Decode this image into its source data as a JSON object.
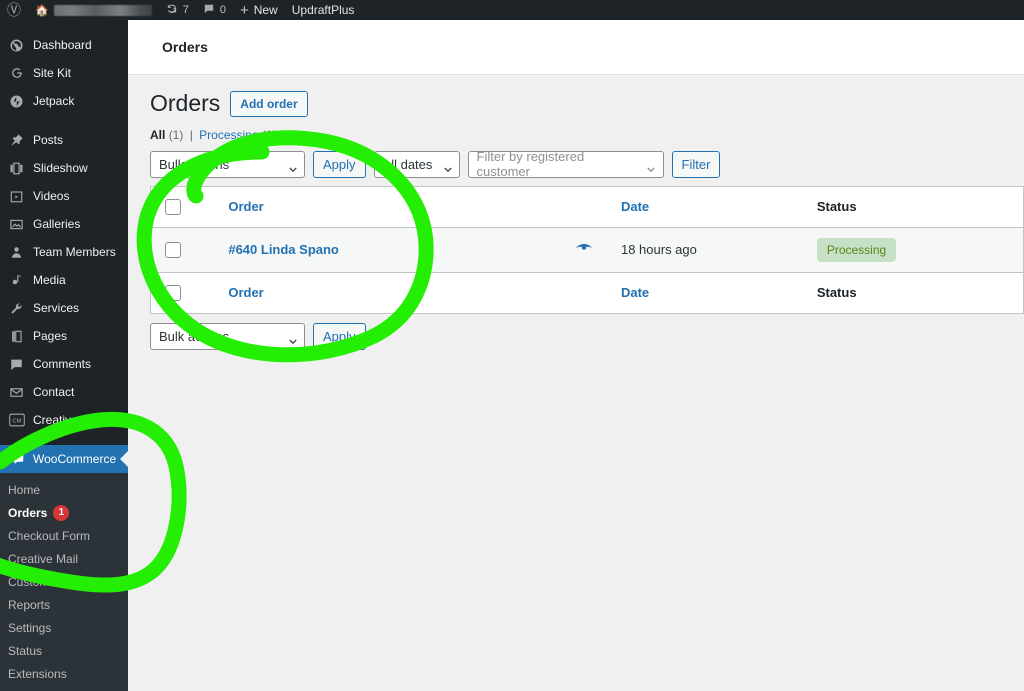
{
  "adminbar": {
    "logo_icon": "wordpress-logo-icon",
    "home_icon": "home-icon",
    "site_name": "",
    "updates_icon": "updates-icon",
    "updates_count": "7",
    "comments_icon": "comment-bubble-icon",
    "comments_count": "0",
    "new_icon": "plus-icon",
    "new_label": "New",
    "updraft_label": "UpdraftPlus"
  },
  "sidebar": {
    "items": [
      {
        "label": "Dashboard",
        "icon": "dashboard-icon"
      },
      {
        "label": "Site Kit",
        "icon": "site-kit-g-icon"
      },
      {
        "label": "Jetpack",
        "icon": "jetpack-icon"
      },
      {
        "label": "Posts",
        "icon": "pin-icon"
      },
      {
        "label": "Slideshow",
        "icon": "slideshow-icon"
      },
      {
        "label": "Videos",
        "icon": "video-icon"
      },
      {
        "label": "Galleries",
        "icon": "gallery-icon"
      },
      {
        "label": "Team Members",
        "icon": "person-icon"
      },
      {
        "label": "Media",
        "icon": "media-icon"
      },
      {
        "label": "Services",
        "icon": "wrench-icon"
      },
      {
        "label": "Pages",
        "icon": "pages-icon"
      },
      {
        "label": "Comments",
        "icon": "comment-bubble-icon"
      },
      {
        "label": "Contact",
        "icon": "envelope-icon"
      },
      {
        "label": "Creative Mail",
        "icon": "creative-mail-cm-icon"
      }
    ],
    "current": {
      "label": "WooCommerce",
      "icon": "woocommerce-icon"
    },
    "submenu": [
      {
        "label": "Home",
        "badge": ""
      },
      {
        "label": "Orders",
        "badge": "1",
        "active": true
      },
      {
        "label": "Checkout Form",
        "badge": ""
      },
      {
        "label": "Creative Mail",
        "badge": ""
      },
      {
        "label": "Customers",
        "badge": ""
      },
      {
        "label": "Reports",
        "badge": ""
      },
      {
        "label": "Settings",
        "badge": ""
      },
      {
        "label": "Status",
        "badge": ""
      },
      {
        "label": "Extensions",
        "badge": ""
      }
    ]
  },
  "header": {
    "breadcrumb": "Orders"
  },
  "main": {
    "title": "Orders",
    "add_order_label": "Add order",
    "views": {
      "all_label": "All",
      "all_count": "(1)",
      "separator": "|",
      "processing_label": "Processing",
      "processing_count": "(1)"
    },
    "toolbar_top": {
      "bulk_actions_value": "Bulk actions",
      "apply_label": "Apply",
      "dates_value": "All dates",
      "customer_placeholder": "Filter by registered customer",
      "filter_label": "Filter"
    },
    "table": {
      "columns": {
        "order": "Order",
        "date": "Date",
        "status": "Status"
      },
      "rows": [
        {
          "order": "#640 Linda Spano",
          "preview_icon": "eye-preview-icon",
          "date": "18 hours ago",
          "status": "Processing",
          "status_color": "#c6e1c6",
          "status_text_color": "#5b841b"
        }
      ]
    },
    "toolbar_bottom": {
      "bulk_actions_value": "Bulk actions",
      "apply_label": "Apply"
    }
  },
  "annotations": {
    "color": "#25ee05",
    "shapes": [
      {
        "name": "table-highlight-ellipse"
      },
      {
        "name": "woocommerce-menu-highlight-ellipse"
      }
    ]
  }
}
